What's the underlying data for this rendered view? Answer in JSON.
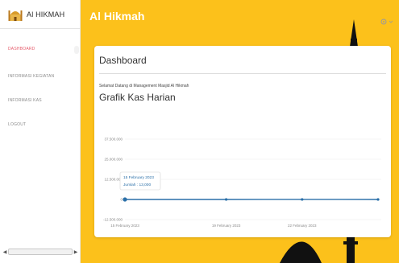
{
  "sidebar": {
    "brand": "Al HIKMAH",
    "items": [
      {
        "label": "DASHBOARD",
        "active": true
      },
      {
        "label": "INFORMASI KEGIATAN",
        "active": false
      },
      {
        "label": "INFORMASI KAS",
        "active": false
      },
      {
        "label": "LOGOUT",
        "active": false
      }
    ]
  },
  "header": {
    "title": "Al Hikmah",
    "settings_icon": "gear-icon"
  },
  "card": {
    "title": "Dashboard",
    "welcome": "Selamat Datang di Management Masjid Al Hikmah",
    "chart_title": "Grafik Kas Harian"
  },
  "chart_data": {
    "type": "line",
    "title": "Grafik Kas Harian",
    "x": [
      "2023-02-15",
      "2023-02-19",
      "2023-02-22",
      "2023-02-25"
    ],
    "values": [
      0,
      0,
      30000,
      0
    ],
    "xticks": [
      "15 February 2023",
      "19 February 2023",
      "22 February 2023"
    ],
    "yticks": [
      "37.500.000",
      "25.000.000",
      "12.500.000",
      "0",
      "-12.500.000"
    ],
    "ylim": [
      -12500000,
      37500000
    ],
    "tooltip": {
      "title": "15 February 2023",
      "label": "Jumlah : 13,000"
    },
    "color": "#2a6fa8",
    "grid": true
  },
  "colors": {
    "accent": "#fcc11b",
    "active_nav": "#e65a6a",
    "line": "#2a6fa8"
  }
}
